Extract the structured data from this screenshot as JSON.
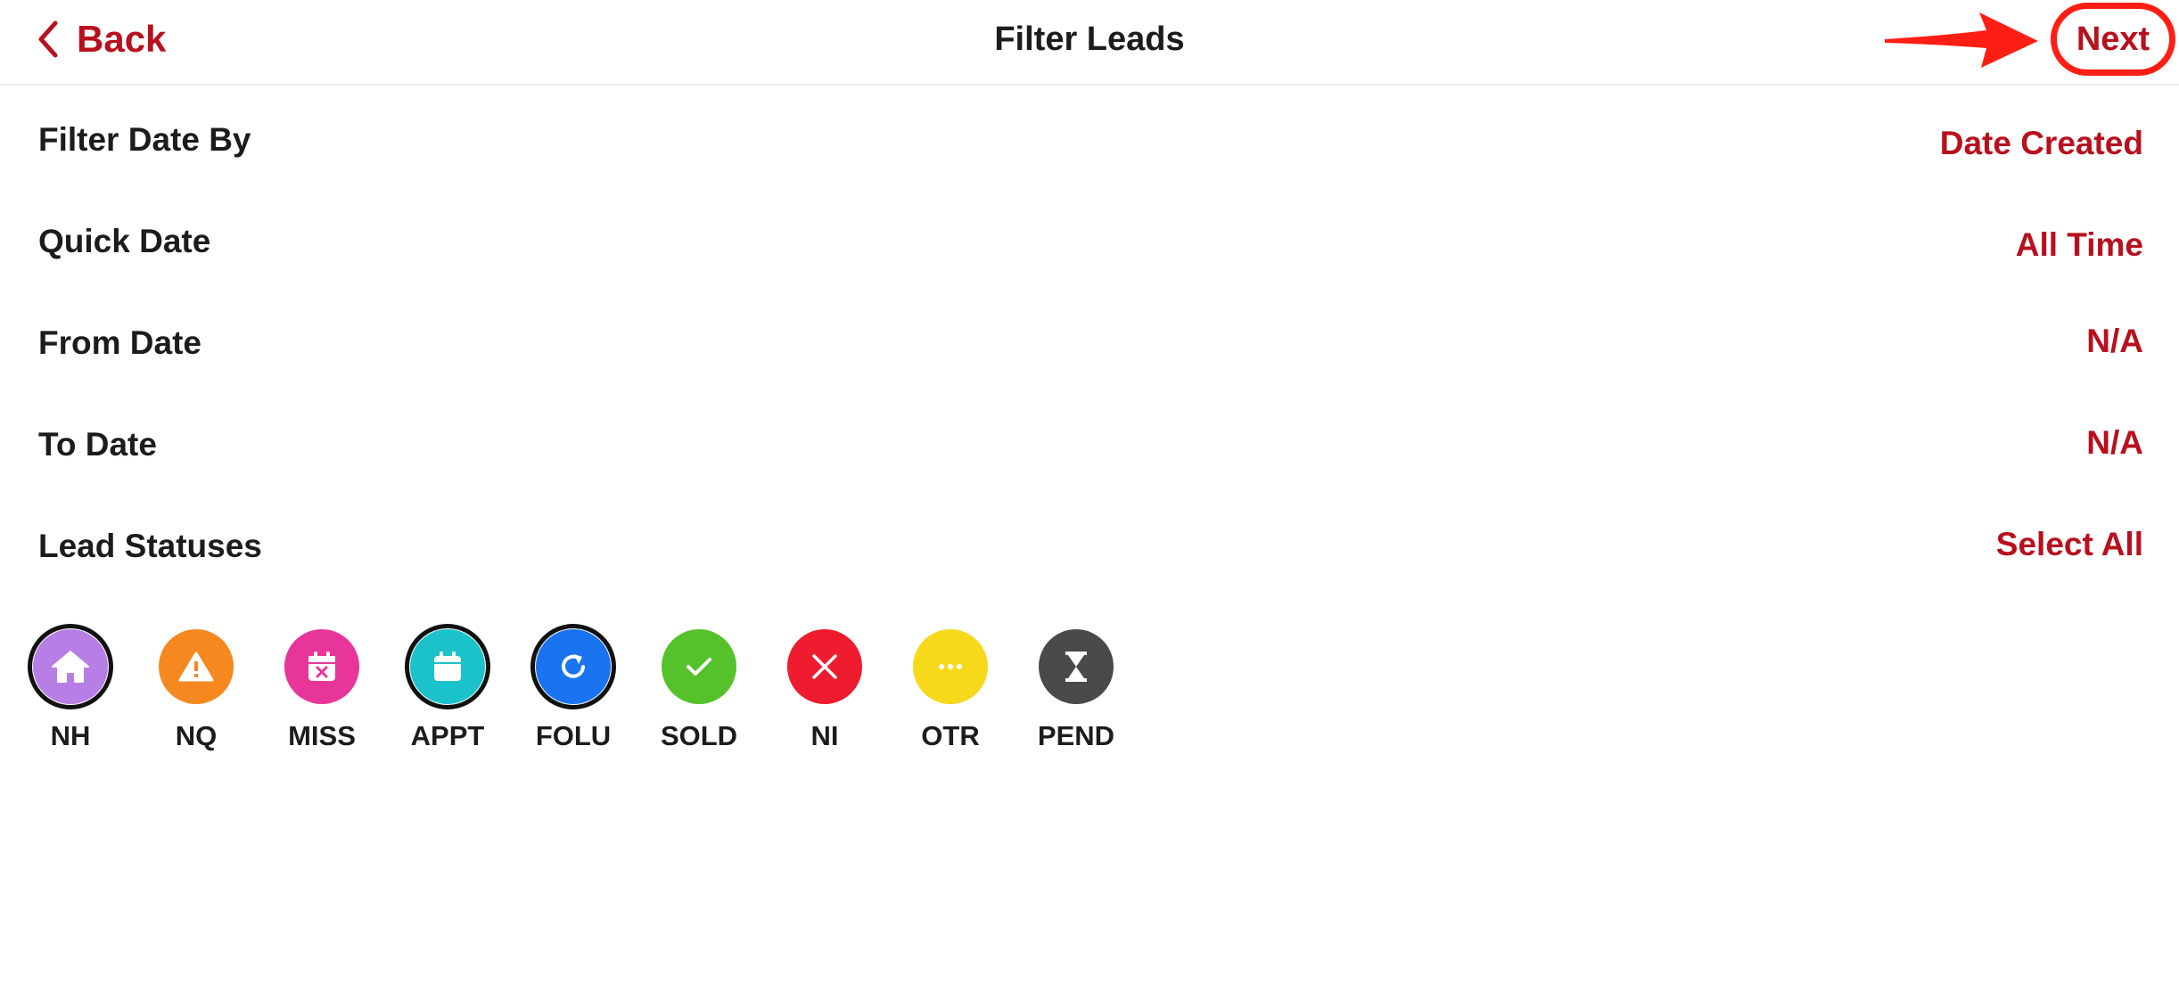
{
  "navbar": {
    "back_label": "Back",
    "title": "Filter Leads",
    "next_label": "Next"
  },
  "rows": [
    {
      "label": "Filter Date By",
      "value": "Date Created"
    },
    {
      "label": "Quick Date",
      "value": "All Time"
    },
    {
      "label": "From Date",
      "value": "N/A"
    },
    {
      "label": "To Date",
      "value": "N/A"
    },
    {
      "label": "Lead Statuses",
      "value": "Select All"
    }
  ],
  "statuses": [
    {
      "code": "NH",
      "icon": "home-icon",
      "color": "#b77ee6",
      "selected": true
    },
    {
      "code": "NQ",
      "icon": "warning-icon",
      "color": "#f5891f",
      "selected": false
    },
    {
      "code": "MISS",
      "icon": "calendar-x-icon",
      "color": "#e8359a",
      "selected": false
    },
    {
      "code": "APPT",
      "icon": "calendar-icon",
      "color": "#1cc2c9",
      "selected": true
    },
    {
      "code": "FOLU",
      "icon": "refresh-icon",
      "color": "#1a73f0",
      "selected": true
    },
    {
      "code": "SOLD",
      "icon": "check-icon",
      "color": "#55c22b",
      "selected": false
    },
    {
      "code": "NI",
      "icon": "x-icon",
      "color": "#ee1c2e",
      "selected": false
    },
    {
      "code": "OTR",
      "icon": "more-icon",
      "color": "#f7d91b",
      "selected": false
    },
    {
      "code": "PEND",
      "icon": "hourglass-icon",
      "color": "#4a4a4a",
      "selected": false
    }
  ],
  "colors": {
    "accent": "#b8101e",
    "annotation": "#ff1e14"
  }
}
